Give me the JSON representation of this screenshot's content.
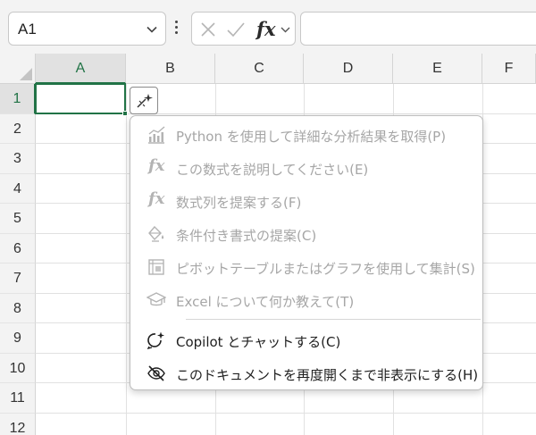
{
  "namebox": {
    "value": "A1"
  },
  "columns": [
    "A",
    "B",
    "C",
    "D",
    "E",
    "F"
  ],
  "rows": [
    "1",
    "2",
    "3",
    "4",
    "5",
    "6",
    "7",
    "8",
    "9",
    "10",
    "11",
    "12"
  ],
  "menu": {
    "items": [
      {
        "label": "Python を使用して詳細な分析結果を取得(P)",
        "icon": "chart-trend-icon",
        "enabled": false
      },
      {
        "label": "この数式を説明してください(E)",
        "icon": "fx-icon",
        "enabled": false
      },
      {
        "label": "数式列を提案する(F)",
        "icon": "fx-icon",
        "enabled": false
      },
      {
        "label": "条件付き書式の提案(C)",
        "icon": "paint-bucket-icon",
        "enabled": false
      },
      {
        "label": "ピボットテーブルまたはグラフを使用して集計(S)",
        "icon": "pivot-table-icon",
        "enabled": false
      },
      {
        "label": "Excel について何か教えて(T)",
        "icon": "graduation-cap-icon",
        "enabled": false
      },
      {
        "label": "Copilot とチャットする(C)",
        "icon": "copilot-chat-icon",
        "enabled": true
      },
      {
        "label": "このドキュメントを再度開くまで非表示にする(H)",
        "icon": "eye-off-icon",
        "enabled": true
      }
    ]
  },
  "colors": {
    "accent": "#217346",
    "disabled_text": "#a6a6a6"
  }
}
